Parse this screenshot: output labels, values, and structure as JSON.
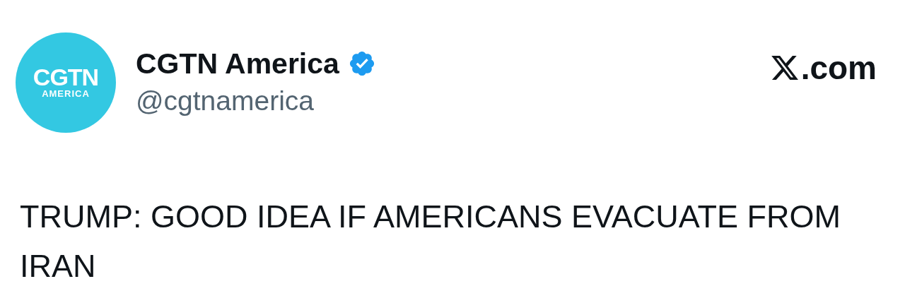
{
  "author": {
    "avatar_lines": [
      "CGTN",
      "AMERICA"
    ],
    "name": "CGTN America",
    "verified": true,
    "handle": "@cgtnamerica"
  },
  "site": {
    "suffix": ".com"
  },
  "tweet": {
    "text": "TRUMP: GOOD IDEA IF AMERICANS EVACUATE FROM IRAN"
  }
}
